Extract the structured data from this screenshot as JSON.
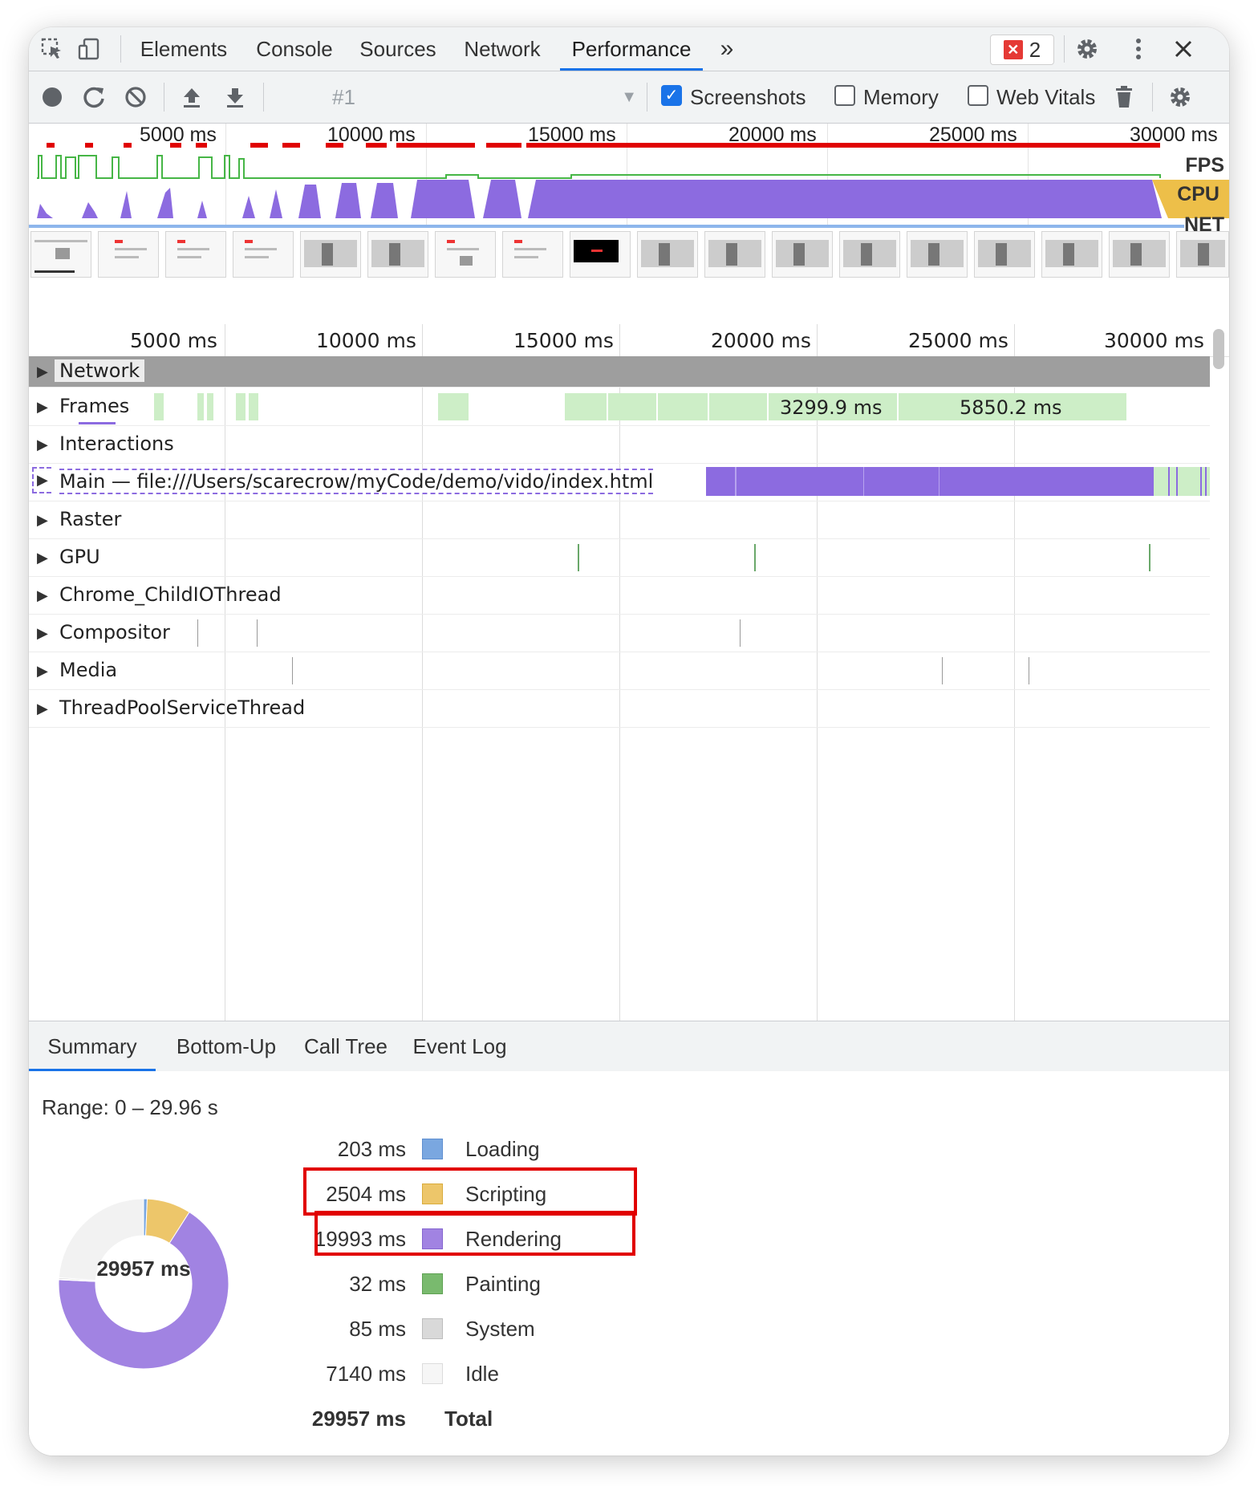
{
  "tabs": {
    "items": [
      {
        "label": "Elements"
      },
      {
        "label": "Console"
      },
      {
        "label": "Sources"
      },
      {
        "label": "Network"
      },
      {
        "label": "Performance"
      }
    ],
    "active": "Performance",
    "more": "»",
    "error_count": "2"
  },
  "toolbar": {
    "profile": "#1",
    "screenshots_label": "Screenshots",
    "screenshots_checked": true,
    "memory_label": "Memory",
    "memory_checked": false,
    "webvitals_label": "Web Vitals",
    "webvitals_checked": false
  },
  "overview": {
    "ticks": [
      "5000 ms",
      "10000 ms",
      "15000 ms",
      "20000 ms",
      "25000 ms",
      "30000 ms"
    ],
    "lanes": {
      "fps": "FPS",
      "cpu": "CPU",
      "net": "NET"
    }
  },
  "timeline": {
    "ticks": [
      "5000 ms",
      "10000 ms",
      "15000 ms",
      "20000 ms",
      "25000 ms",
      "30000 ms"
    ],
    "tracks": [
      {
        "label": "Network"
      },
      {
        "label": "Frames"
      },
      {
        "label": "Interactions"
      },
      {
        "label": "Main — file:///Users/scarecrow/myCode/demo/vido/index.html"
      },
      {
        "label": "Raster"
      },
      {
        "label": "GPU"
      },
      {
        "label": "Chrome_ChildIOThread"
      },
      {
        "label": "Compositor"
      },
      {
        "label": "Media"
      },
      {
        "label": "ThreadPoolServiceThread"
      }
    ],
    "frame_labels": [
      "3299.9 ms",
      "5850.2 ms"
    ]
  },
  "bottom_tabs": {
    "items": [
      {
        "label": "Summary"
      },
      {
        "label": "Bottom-Up"
      },
      {
        "label": "Call Tree"
      },
      {
        "label": "Event Log"
      }
    ],
    "active": "Summary"
  },
  "summary": {
    "range": "Range: 0 – 29.96 s",
    "total_center": "29957 ms",
    "rows": [
      {
        "value": "203 ms",
        "label": "Loading",
        "color": "#7aa7e0",
        "ms": 203
      },
      {
        "value": "2504 ms",
        "label": "Scripting",
        "color": "#edc66a",
        "ms": 2504
      },
      {
        "value": "19993 ms",
        "label": "Rendering",
        "color": "#a183e2",
        "ms": 19993
      },
      {
        "value": "32 ms",
        "label": "Painting",
        "color": "#79ba6e",
        "ms": 32
      },
      {
        "value": "85 ms",
        "label": "System",
        "color": "#d9d9d9",
        "ms": 85
      },
      {
        "value": "7140 ms",
        "label": "Idle",
        "color": "#f4f4f4",
        "ms": 7140
      }
    ],
    "total_value": "29957 ms",
    "total_label": "Total"
  },
  "colors": {
    "accent": "#1a73e8",
    "rendering": "#8c6be0",
    "frames": "#cdeec7",
    "highlight": "#e10000"
  }
}
